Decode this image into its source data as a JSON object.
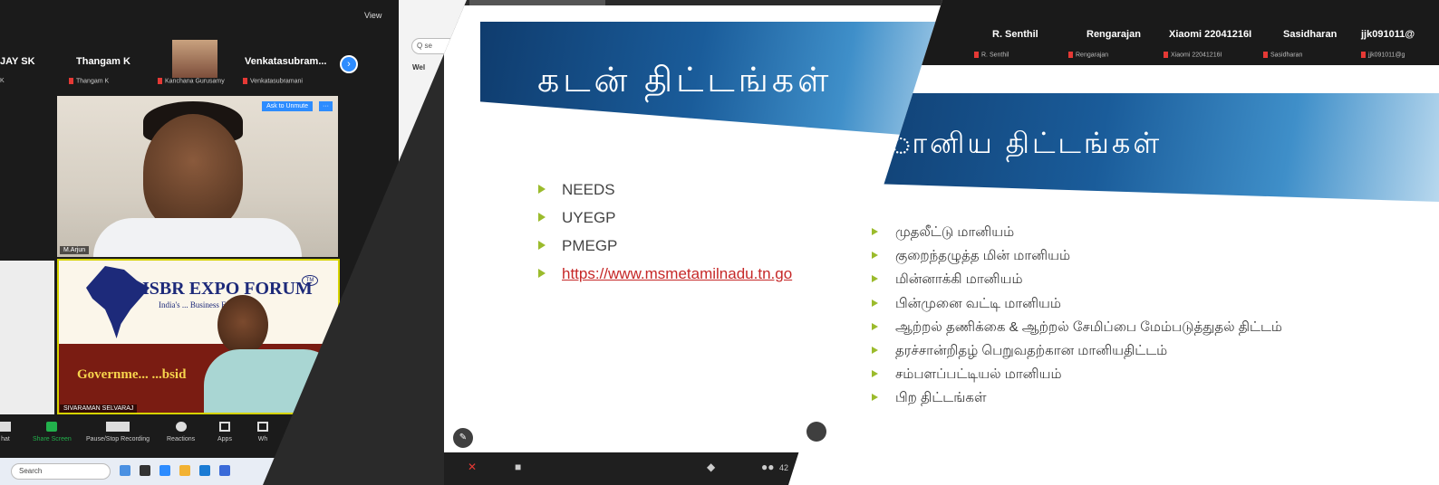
{
  "zoom": {
    "view_label": "View",
    "search_placeholder": "Q se",
    "side_heading": "Wel",
    "participants": [
      {
        "name": "JAY SK",
        "sub": "K"
      },
      {
        "name": "Thangam K",
        "sub": "Thangam K"
      },
      {
        "name": "",
        "sub": "Kanchana Gurusamy"
      },
      {
        "name": "Venkatasubram...",
        "sub": "Venkatasubramani"
      }
    ],
    "main_video": {
      "ask_label": "Ask to Unmute",
      "more_label": "···",
      "name_tag": "M.Arjun"
    },
    "poster": {
      "title": "ISBR EXPO FORUM",
      "tm": "TM",
      "subtitle": "India's ... Business Exposition",
      "band_text": "Governme... ...bsid",
      "speaker_tag": "SIVARAMAN SELVARAJ"
    },
    "controls": [
      {
        "label": "hat"
      },
      {
        "label": "Share Screen"
      },
      {
        "label": "Pause/Stop Recording"
      },
      {
        "label": "Reactions"
      },
      {
        "label": "Apps"
      },
      {
        "label": "Wh"
      }
    ],
    "taskbar_search": "Search"
  },
  "slide_loans": {
    "title": "கடன் திட்டங்கள்",
    "items": [
      "NEEDS",
      "UYEGP",
      "PMEGP",
      "https://www.msmetamilnadu.tn.go"
    ],
    "participant_count": "42"
  },
  "slide_subsidy": {
    "participants": [
      {
        "name": "R. Senthil",
        "sub": "R. Senthil"
      },
      {
        "name": "Rengarajan",
        "sub": "Rengarajan"
      },
      {
        "name": "Xiaomi 22041216I",
        "sub": "Xiaomi 22041216I"
      },
      {
        "name": "Sasidharan",
        "sub": "Sasidharan"
      },
      {
        "name": "jjk091011@",
        "sub": "jjk091011@g"
      }
    ],
    "title": "ானிய திட்டங்கள்",
    "items": [
      "முதலீட்டு மானியம்",
      "குறைந்தழுத்த மின் மானியம்",
      "மின்னாக்கி மானியம்",
      "பின்முனை வட்டி மானியம்",
      "ஆற்றல் தணிக்கை & ஆற்றல் சேமிப்பை மேம்படுத்துதல் திட்டம்",
      "தரச்சான்றிதழ் பெறுவதற்கான மானியதிட்டம்",
      "சம்பளப்பட்டியல் மானியம்",
      "பிற திட்டங்கள்"
    ]
  },
  "colors": {
    "frame": "#0f2a4d",
    "header_dark": "#0f3c6e",
    "bullet": "#9bbb2c",
    "zoom_blue": "#2d8cff",
    "link_red": "#c62828"
  }
}
